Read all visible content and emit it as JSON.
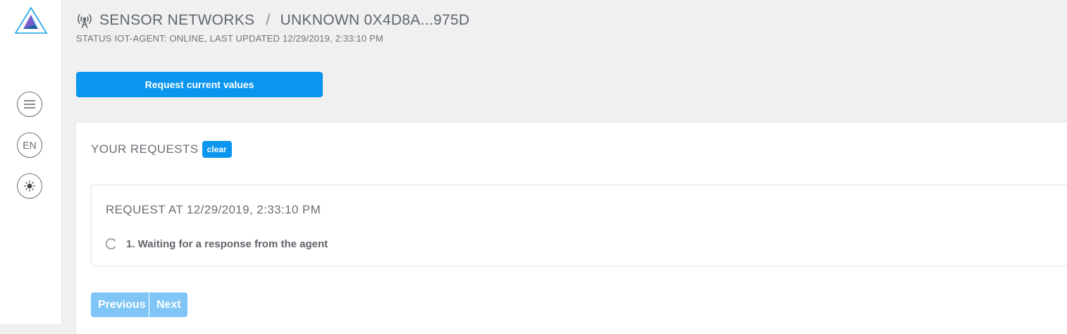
{
  "sidebar": {
    "logo_icon": "triangle-logo-icon",
    "menu_icon": "hamburger-menu-icon",
    "language_label": "EN",
    "theme_icon": "sun-icon"
  },
  "header": {
    "network_icon": "antenna-icon",
    "section": "SENSOR NETWORKS",
    "separator": "/",
    "device": "UNKNOWN 0X4D8A...975D",
    "status": "STATUS IOT-AGENT: ONLINE, LAST UPDATED 12/29/2019, 2:33:10 PM"
  },
  "actions": {
    "request_button": "Request current values"
  },
  "requests": {
    "title": "YOUR REQUESTS",
    "clear_label": "clear",
    "items": [
      {
        "title": "REQUEST AT 12/29/2019, 2:33:10 PM",
        "step": "1. Waiting for a response from the agent",
        "step_icon": "loading-spinner-icon"
      }
    ]
  },
  "pagination": {
    "previous_label": "Previous",
    "next_label": "Next"
  },
  "colors": {
    "accent": "#0a96ee",
    "accent_disabled": "#7fc6f6",
    "background": "#f0f0f0"
  }
}
